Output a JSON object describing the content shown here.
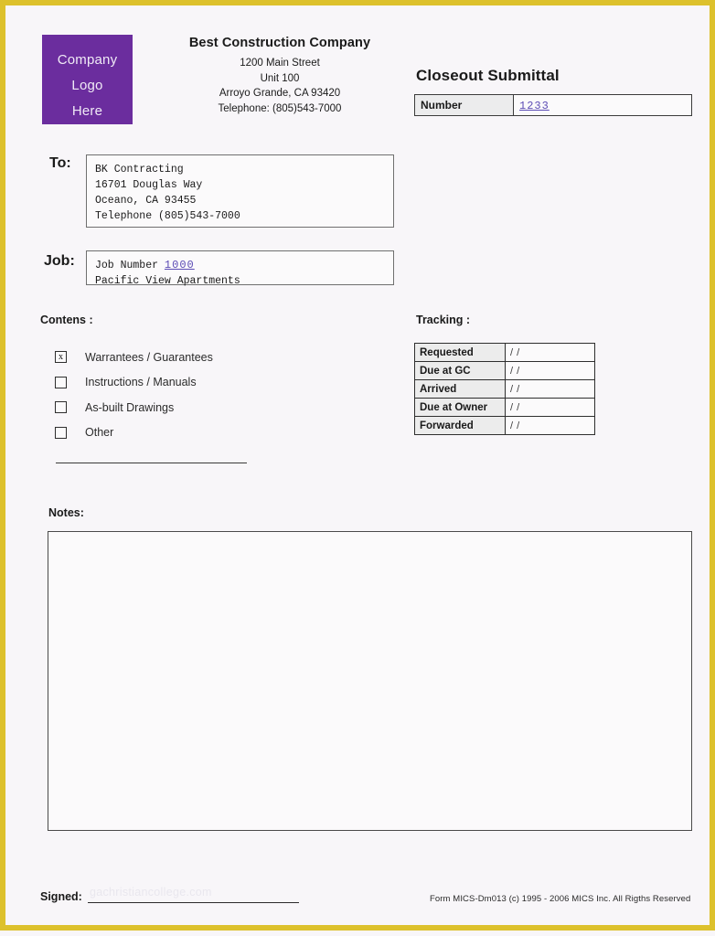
{
  "page": {
    "border_color": "#ddc12c",
    "background_color": "#f8f6f9"
  },
  "logo": {
    "background_color": "#6b2d9e",
    "line1": "Company",
    "line2": "Logo",
    "line3": "Here"
  },
  "company": {
    "name": "Best Construction Company",
    "address_line1": "1200 Main Street",
    "address_line2": "Unit 100",
    "address_line3": "Arroyo Grande, CA 93420",
    "telephone": "Telephone: (805)543-7000"
  },
  "document": {
    "title": "Closeout Submittal",
    "number_label": "Number",
    "number_value": "1233",
    "number_value_color": "#5b4bb5"
  },
  "recipient": {
    "label": "To:",
    "lines": [
      "BK Contracting",
      "16701 Douglas Way",
      "Oceano, CA 93455",
      "Telephone (805)543-7000"
    ]
  },
  "job": {
    "label": "Job:",
    "number_prefix": "Job Number",
    "number_value": "1000",
    "number_value_color": "#5b4bb5",
    "name": "Pacific View Apartments"
  },
  "contents": {
    "caption": "Contens :",
    "items": [
      {
        "label": "Warrantees / Guarantees",
        "checked": true,
        "mark": "x"
      },
      {
        "label": "Instructions / Manuals",
        "checked": false,
        "mark": ""
      },
      {
        "label": "As-built Drawings",
        "checked": false,
        "mark": ""
      },
      {
        "label": "Other",
        "checked": false,
        "mark": ""
      }
    ]
  },
  "tracking": {
    "caption": "Tracking :",
    "rows": [
      {
        "label": "Requested",
        "value": "/   /"
      },
      {
        "label": "Due at GC",
        "value": "/   /"
      },
      {
        "label": "Arrived",
        "value": "/   /"
      },
      {
        "label": "Due at Owner",
        "value": "/   /"
      },
      {
        "label": "Forwarded",
        "value": "/   /"
      }
    ]
  },
  "notes": {
    "caption": "Notes:",
    "value": ""
  },
  "footer": {
    "signed_label": "Signed:",
    "watermark": "gachristiancollege.com",
    "form_credit": "Form MICS-Dm013 (c) 1995 - 2006 MICS Inc. All Rigths Reserved"
  }
}
